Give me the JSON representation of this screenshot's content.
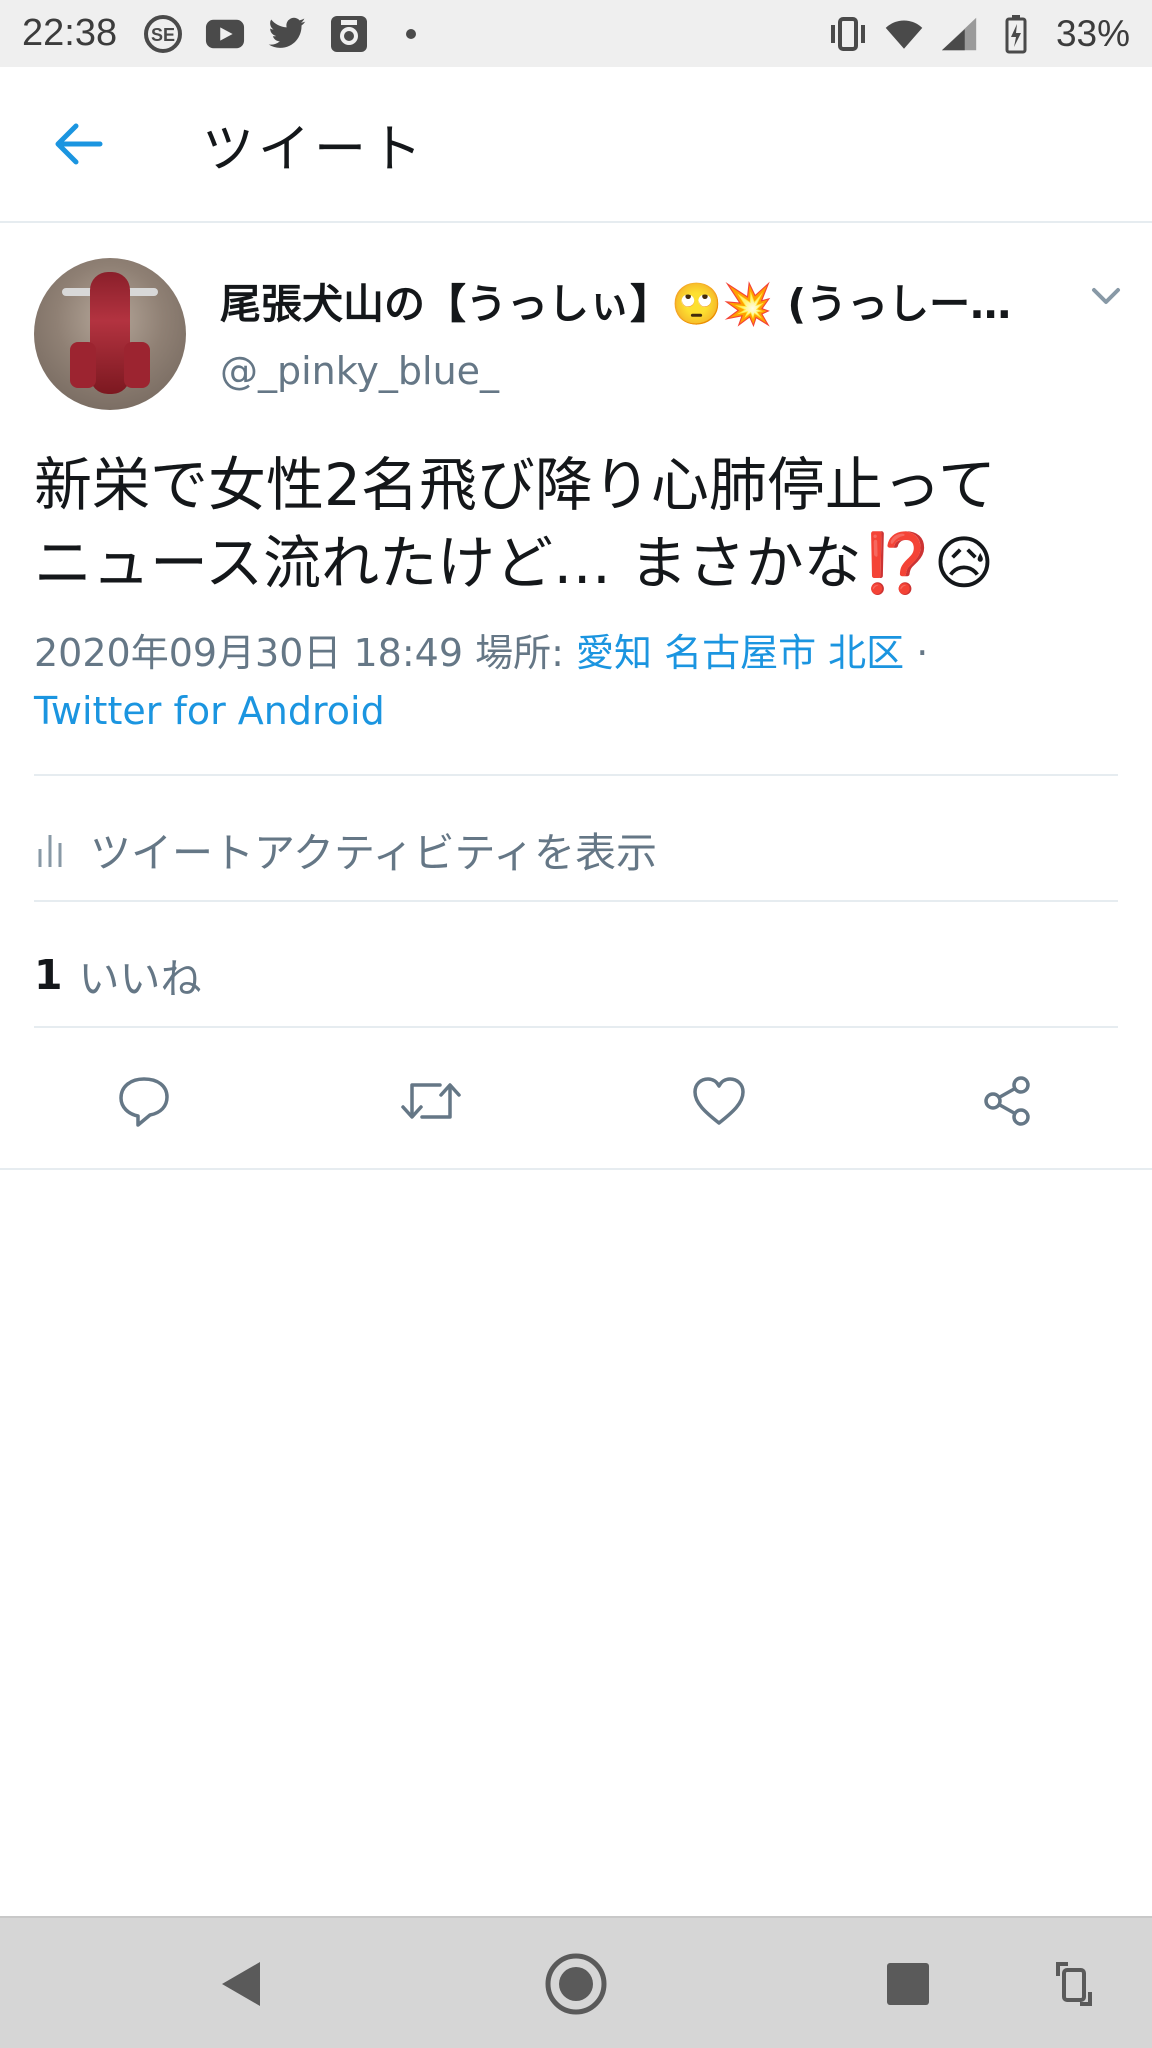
{
  "status_bar": {
    "time": "22:38",
    "battery": "33%",
    "icons_left": [
      "se-icon",
      "youtube-icon",
      "twitter-icon",
      "camera-icon",
      "dot-icon"
    ],
    "icons_right": [
      "vibrate-icon",
      "wifi-icon",
      "signal-icon",
      "battery-icon"
    ]
  },
  "app_bar": {
    "title": "ツイート",
    "back_icon": "arrow-left-icon"
  },
  "tweet": {
    "display_name": "尾張犬山の【うっしぃ】🙄💥 (うっしー…",
    "handle": "@_pinky_blue_",
    "text_line1": "新栄で女性2名飛び降り心肺停止って",
    "text_line2": "ニュース流れたけど… まさかな⁉️😥",
    "date": "2020年09月30日 18:49",
    "place_label": "場所:",
    "place": "愛知 名古屋市 北区",
    "separator": "·",
    "source": "Twitter for Android",
    "activity_label": "ツイートアクティビティを表示",
    "likes_count": "1",
    "likes_label": "いいね"
  },
  "colors": {
    "accent": "#1b95e0",
    "secondary_text": "#657786",
    "divider": "#e6ecf0"
  }
}
